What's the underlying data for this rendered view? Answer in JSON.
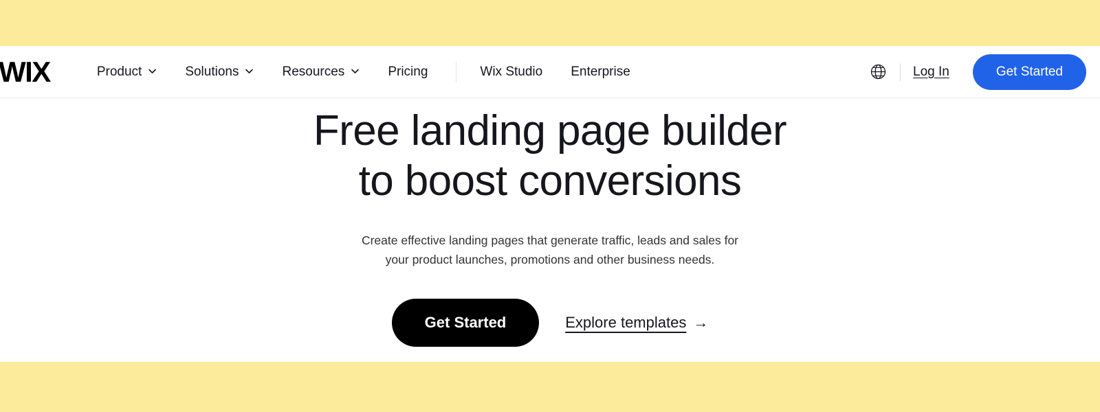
{
  "theme": {
    "band_color": "#fdeb9c",
    "nav_cta_color": "#2163e8",
    "hero_cta_color": "#000000",
    "text_color": "#16161d"
  },
  "header": {
    "logo": "WIX",
    "nav_items": [
      {
        "label": "Product",
        "has_dropdown": true,
        "icon": "chevron-down-icon"
      },
      {
        "label": "Solutions",
        "has_dropdown": true,
        "icon": "chevron-down-icon"
      },
      {
        "label": "Resources",
        "has_dropdown": true,
        "icon": "chevron-down-icon"
      },
      {
        "label": "Pricing",
        "has_dropdown": false,
        "icon": ""
      },
      {
        "label": "Wix Studio",
        "has_dropdown": false,
        "icon": ""
      },
      {
        "label": "Enterprise",
        "has_dropdown": false,
        "icon": ""
      }
    ],
    "language_icon": "globe-icon",
    "login_label": "Log In",
    "cta_label": "Get Started"
  },
  "hero": {
    "title_line1": "Free landing page builder",
    "title_line2": "to boost conversions",
    "subtitle_line1": "Create effective landing pages that generate traffic, leads and sales for",
    "subtitle_line2": "your product launches, promotions and other business needs.",
    "primary_cta": "Get Started",
    "secondary_cta": "Explore templates",
    "secondary_cta_arrow": "→"
  }
}
